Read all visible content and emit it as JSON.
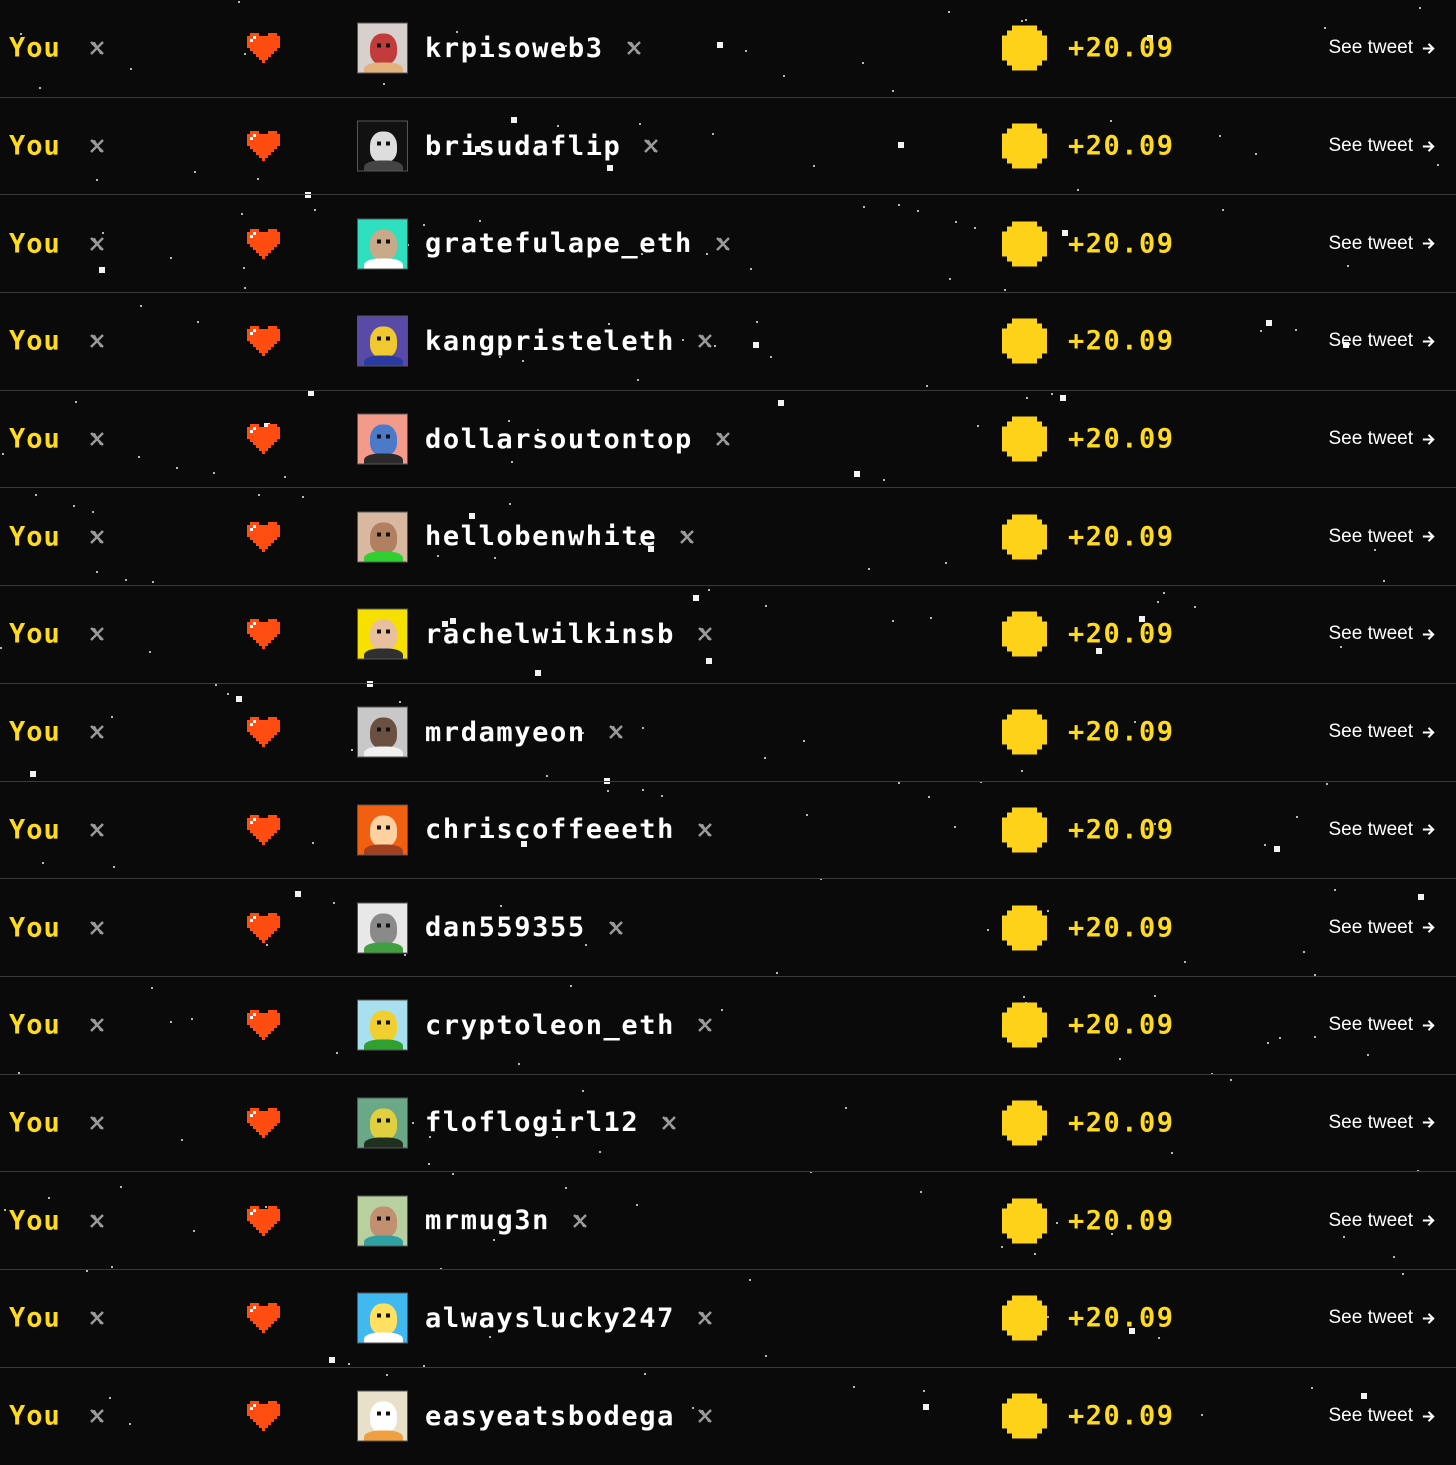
{
  "colors": {
    "background": "#0a0a0a",
    "you_text": "#ffdb1f",
    "points_text": "#ffdb1f",
    "heart": "#ff4d12",
    "coin": "#ffd21a",
    "divider": "#3a3a3a",
    "icon_gray": "#9a9a9a"
  },
  "icons": {
    "x_icon": "x-logo-icon",
    "heart": "pixel-heart-icon",
    "coin": "pixel-coin-icon",
    "see_arrow": "arrow-right-icon"
  },
  "rows": [
    {
      "you": "You",
      "handle": "krpisoweb3",
      "points": "+20.09",
      "see": "See tweet",
      "avatar": {
        "bg": "#d8d0cc",
        "face": "#c23c3c",
        "body": "#e3b27a"
      }
    },
    {
      "you": "You",
      "handle": "brisudaflip",
      "points": "+20.09",
      "see": "See tweet",
      "avatar": {
        "bg": "#111111",
        "face": "#dddddd",
        "body": "#444444"
      }
    },
    {
      "you": "You",
      "handle": "gratefulape_eth",
      "points": "+20.09",
      "see": "See tweet",
      "avatar": {
        "bg": "#2ee0c0",
        "face": "#c8a98a",
        "body": "#ffffff"
      }
    },
    {
      "you": "You",
      "handle": "kangpristeleth",
      "points": "+20.09",
      "see": "See tweet",
      "avatar": {
        "bg": "#5a4aa8",
        "face": "#f0c830",
        "body": "#2a3aa0"
      }
    },
    {
      "you": "You",
      "handle": "dollarsoutontop",
      "points": "+20.09",
      "see": "See tweet",
      "avatar": {
        "bg": "#f49a8a",
        "face": "#4a7ac8",
        "body": "#2a2a2a"
      }
    },
    {
      "you": "You",
      "handle": "hellobenwhite",
      "points": "+20.09",
      "see": "See tweet",
      "avatar": {
        "bg": "#d8b8a0",
        "face": "#b08060",
        "body": "#30d030"
      }
    },
    {
      "you": "You",
      "handle": "rachelwilkinsb",
      "points": "+20.09",
      "see": "See tweet",
      "avatar": {
        "bg": "#f5e000",
        "face": "#e8c0a0",
        "body": "#303030"
      }
    },
    {
      "you": "You",
      "handle": "mrdamyeon",
      "points": "+20.09",
      "see": "See tweet",
      "avatar": {
        "bg": "#c8c8c8",
        "face": "#6a5040",
        "body": "#f0f0f0"
      }
    },
    {
      "you": "You",
      "handle": "chriscoffeeeth",
      "points": "+20.09",
      "see": "See tweet",
      "avatar": {
        "bg": "#f06010",
        "face": "#ffd0a0",
        "body": "#a04020"
      }
    },
    {
      "you": "You",
      "handle": "dan559355",
      "points": "+20.09",
      "see": "See tweet",
      "avatar": {
        "bg": "#e8e8e8",
        "face": "#8a8a8a",
        "body": "#40a040"
      }
    },
    {
      "you": "You",
      "handle": "cryptoleon_eth",
      "points": "+20.09",
      "see": "See tweet",
      "avatar": {
        "bg": "#a8e0f0",
        "face": "#f0d030",
        "body": "#30a030"
      }
    },
    {
      "you": "You",
      "handle": "floflogirl12",
      "points": "+20.09",
      "see": "See tweet",
      "avatar": {
        "bg": "#6aa888",
        "face": "#e0d040",
        "body": "#203020"
      }
    },
    {
      "you": "You",
      "handle": "mrmug3n",
      "points": "+20.09",
      "see": "See tweet",
      "avatar": {
        "bg": "#b8d0a0",
        "face": "#c09070",
        "body": "#30a0a0"
      }
    },
    {
      "you": "You",
      "handle": "alwayslucky247",
      "points": "+20.09",
      "see": "See tweet",
      "avatar": {
        "bg": "#40b8f0",
        "face": "#ffe060",
        "body": "#ffffff"
      }
    },
    {
      "you": "You",
      "handle": "easyeatsbodega",
      "points": "+20.09",
      "see": "See tweet",
      "avatar": {
        "bg": "#e8e0c8",
        "face": "#ffffff",
        "body": "#f0a040"
      }
    }
  ]
}
